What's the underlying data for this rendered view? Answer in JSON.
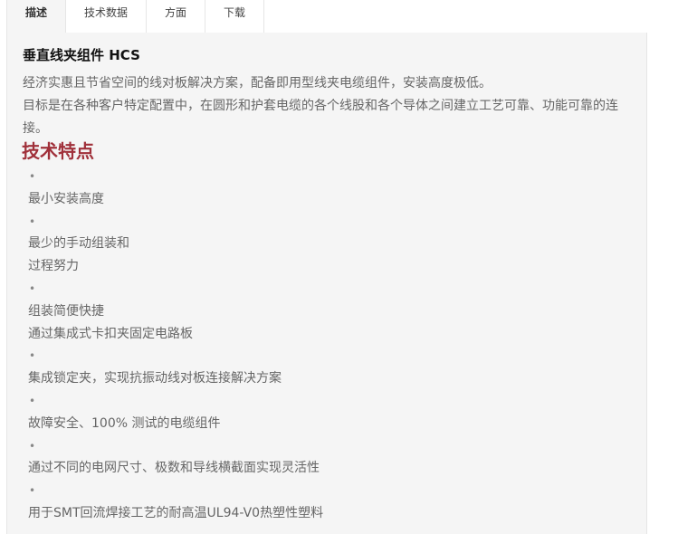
{
  "tabs": [
    {
      "label": "描述",
      "active": true
    },
    {
      "label": "技术数据",
      "active": false
    },
    {
      "label": "方面",
      "active": false
    },
    {
      "label": "下载",
      "active": false
    }
  ],
  "product": {
    "title": "垂直线夹组件 HCS",
    "description_1": "经济实惠且节省空间的线对板解决方案，配备即用型线夹电缆组件，安装高度极低。",
    "description_2": "目标是在各种客户特定配置中，在圆形和护套电缆的各个线股和各个导体之间建立工艺可靠、功能可靠的连接。"
  },
  "features": {
    "heading": "技术特点",
    "bullet_symbol": "•",
    "items": [
      {
        "lines": [
          "最小安装高度"
        ]
      },
      {
        "lines": [
          "最少的手动组装和",
          "过程努力"
        ]
      },
      {
        "lines": [
          "组装简便快捷",
          "通过集成式卡扣夹固定电路板"
        ]
      },
      {
        "lines": [
          "集成锁定夹，实现抗振动线对板连接解决方案"
        ]
      },
      {
        "lines": [
          "故障安全、100% 测试的电缆组件"
        ]
      },
      {
        "lines": [
          "通过不同的电网尺寸、极数和导线横截面实现灵活性"
        ]
      },
      {
        "lines": [
          "用于SMT回流焊接工艺的耐高温UL94-V0热塑性塑料"
        ]
      }
    ]
  },
  "colors": {
    "heading_accent": "#a0303a",
    "panel_background": "#f5f5f5",
    "body_text": "#666666"
  }
}
